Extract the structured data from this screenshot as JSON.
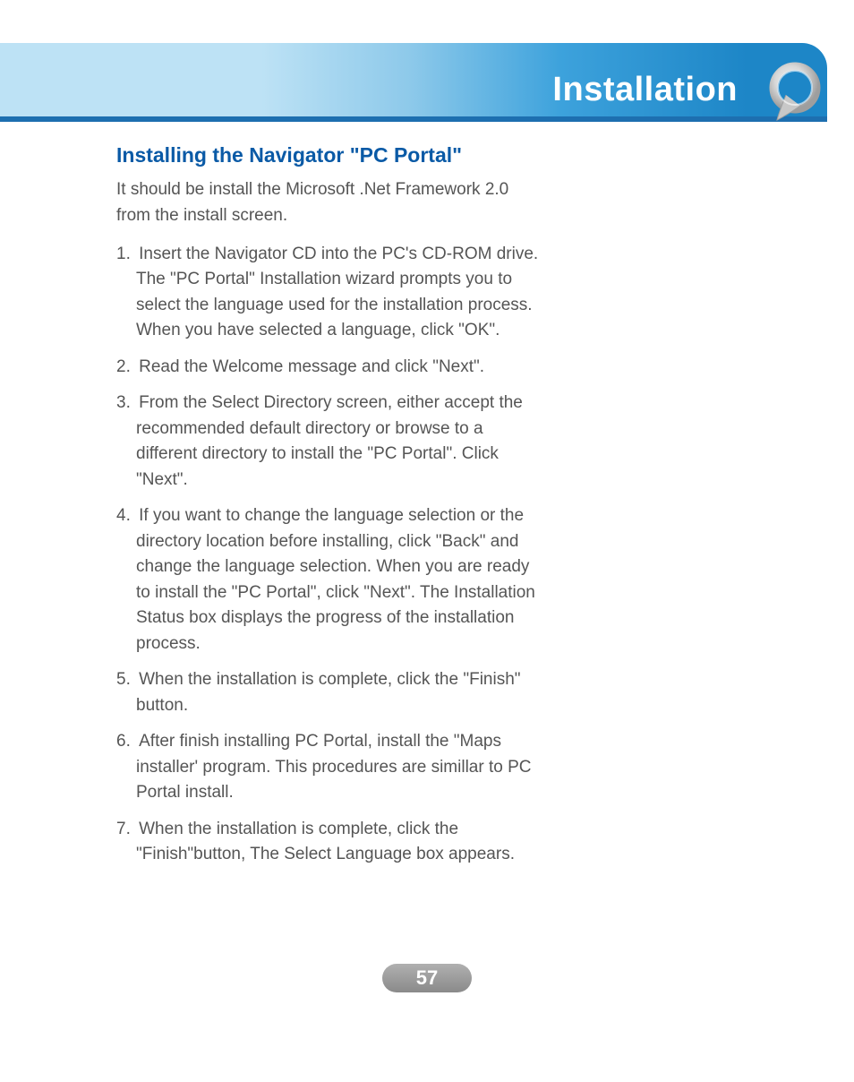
{
  "header": {
    "title": "Installation"
  },
  "section": {
    "title": "Installing the Navigator \"PC Portal\"",
    "intro": "It should be install the Microsoft .Net Framework 2.0 from the install screen.",
    "steps": [
      "Insert the Navigator CD into the PC's CD-ROM drive. The \"PC Portal\" Installation wizard prompts you to select the language used for the installation process. When you have selected a language, click \"OK\".",
      "Read the Welcome message and click \"Next\".",
      "From the Select Directory screen, either accept the recommended default directory or browse to a different directory to install the \"PC Portal\". Click \"Next\".",
      "If you want to change the language selection or the directory location before installing, click \"Back\" and change the language selection. When you are ready to install the \"PC Portal\", click \"Next\". The Installation Status box displays the progress of the installation process.",
      "When the installation is complete, click the \"Finish\" button.",
      "After finish installing PC Portal, install the \"Maps installer' program. This procedures are simillar to PC Portal install.",
      "When the installation is complete, click the \"Finish\"button, The Select Language box appears."
    ]
  },
  "page": {
    "number": "57"
  }
}
